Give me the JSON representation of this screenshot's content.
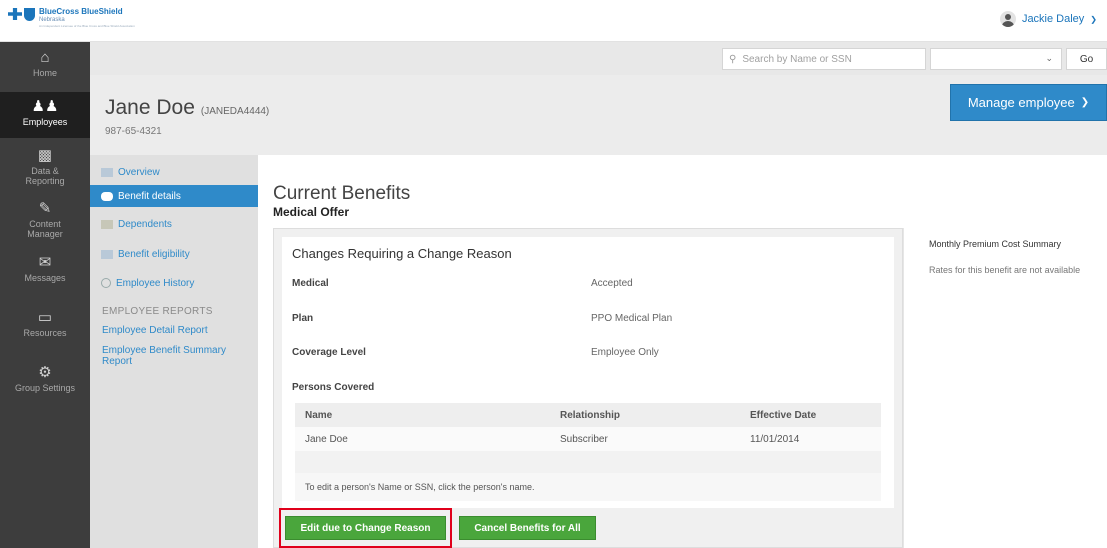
{
  "brand": {
    "name": "BlueCross BlueShield",
    "region": "Nebraska",
    "tagline": "An Independent Licensee of the Blue Cross and Blue Shield Association"
  },
  "user": {
    "name": "Jackie Daley",
    "icon": "user-avatar-icon"
  },
  "leftnav": [
    {
      "label": "Home",
      "icon": "home-icon"
    },
    {
      "label": "Employees",
      "icon": "people-icon",
      "active": true
    },
    {
      "label": "Data & Reporting",
      "icon": "bar-chart-icon"
    },
    {
      "label": "Content Manager",
      "icon": "edit-icon"
    },
    {
      "label": "Messages",
      "icon": "envelope-icon"
    },
    {
      "label": "Resources",
      "icon": "book-icon"
    },
    {
      "label": "Group Settings",
      "icon": "gears-icon"
    }
  ],
  "search": {
    "placeholder": "Search by Name or SSN",
    "go_label": "Go",
    "icon": "search-icon"
  },
  "employee": {
    "name": "Jane Doe",
    "id": "(JANEDA4444)",
    "ssn": "987-65-4321",
    "manage_label": "Manage employee"
  },
  "subnav": {
    "items": [
      {
        "label": "Overview",
        "icon": "overview-icon"
      },
      {
        "label": "Benefit details",
        "icon": "benefit-icon",
        "active": true
      },
      {
        "label": "Dependents",
        "icon": "dependents-icon"
      },
      {
        "label": "Benefit eligibility",
        "icon": "eligibility-icon"
      },
      {
        "label": "Employee History",
        "icon": "history-icon"
      }
    ],
    "reports_heading": "EMPLOYEE REPORTS",
    "reports": [
      {
        "label": "Employee Detail Report"
      },
      {
        "label": "Employee Benefit Summary Report"
      }
    ]
  },
  "main": {
    "title": "Current Benefits",
    "subtitle": "Medical Offer",
    "card_title": "Changes Requiring a Change Reason",
    "fields": [
      {
        "label": "Medical",
        "value": "Accepted"
      },
      {
        "label": "Plan",
        "value": "PPO Medical Plan"
      },
      {
        "label": "Coverage Level",
        "value": "Employee Only"
      },
      {
        "label": "Persons Covered",
        "value": ""
      }
    ],
    "persons_table": {
      "headers": [
        "Name",
        "Relationship",
        "Effective Date"
      ],
      "rows": [
        [
          "Jane Doe",
          "Subscriber",
          "11/01/2014"
        ]
      ],
      "note": "To edit a person's Name or SSN, click the person's name."
    },
    "actions": {
      "edit_label": "Edit due to Change Reason",
      "cancel_label": "Cancel Benefits for All"
    }
  },
  "side_panel": {
    "title": "Monthly Premium Cost Summary",
    "text": "Rates for this benefit are not available"
  },
  "colors": {
    "brand_blue": "#1b75bb",
    "accent_blue": "#2f8ac9",
    "green": "#4aa63c",
    "highlight_red": "#e0001b",
    "nav_dark": "#3d3d3d"
  }
}
